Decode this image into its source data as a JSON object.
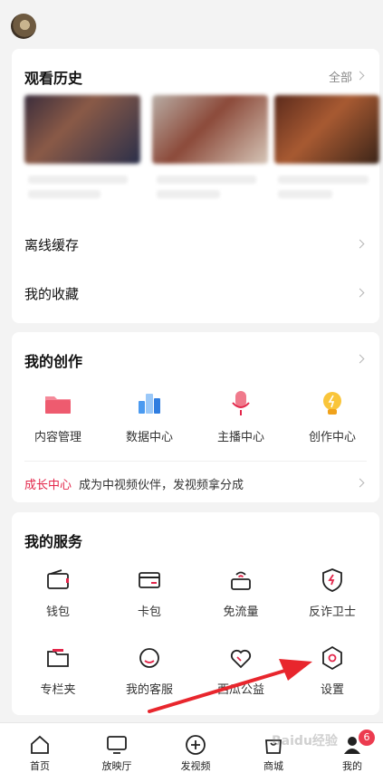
{
  "history": {
    "title": "观看历史",
    "all_label": "全部"
  },
  "rows": {
    "offline": "离线缓存",
    "favorites": "我的收藏"
  },
  "creation": {
    "title": "我的创作",
    "items": [
      "内容管理",
      "数据中心",
      "主播中心",
      "创作中心"
    ],
    "growth_label": "成长中心",
    "growth_text": "成为中视频伙伴，发视频拿分成"
  },
  "service": {
    "title": "我的服务",
    "items": [
      "钱包",
      "卡包",
      "免流量",
      "反诈卫士",
      "专栏夹",
      "我的客服",
      "西瓜公益",
      "设置"
    ]
  },
  "bottom_nav": {
    "items": [
      "首页",
      "放映厅",
      "发视频",
      "商城",
      "我的"
    ],
    "badge": "6"
  },
  "watermark": "Baidu经验",
  "colors": {
    "accent": "#e3264a",
    "arrow": "#e8262d"
  }
}
